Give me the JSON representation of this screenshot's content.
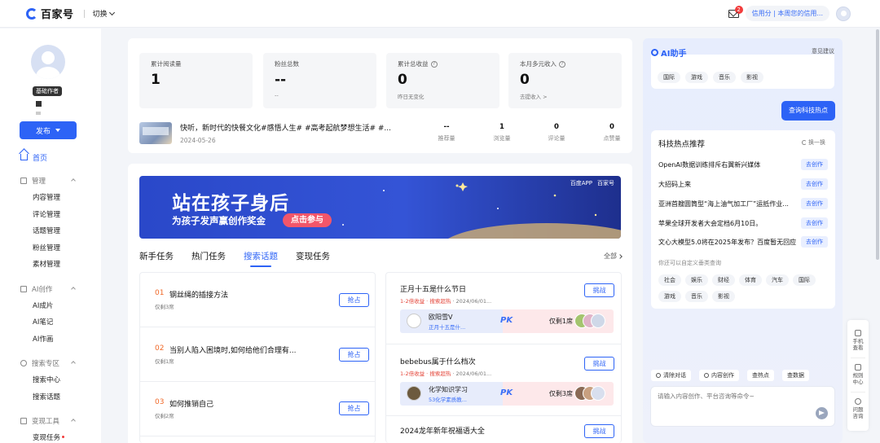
{
  "topbar": {
    "brand": "百家号",
    "switch_label": "切换",
    "mail_badge": "2",
    "credit_text": "信用分 | 本周您的信用..."
  },
  "sidebar": {
    "level_tag": "基础作者",
    "publish_label": "发布",
    "home_label": "首页",
    "groups": [
      {
        "title": "管理",
        "items": [
          "内容管理",
          "评论管理",
          "话题管理",
          "粉丝管理",
          "素材管理"
        ]
      },
      {
        "title": "AI创作",
        "items": [
          "AI成片",
          "AI笔记",
          "AI作画"
        ]
      },
      {
        "title": "搜索专区",
        "items": [
          "搜索中心",
          "搜索话题"
        ]
      },
      {
        "title": "变现工具",
        "items": [
          "变现任务"
        ]
      }
    ]
  },
  "stats": [
    {
      "label": "累计阅读量",
      "value": "1",
      "sub": ""
    },
    {
      "label": "粉丝总数",
      "value": "--",
      "sub": "--"
    },
    {
      "label": "累计总收益",
      "value": "0",
      "sub": "昨日无变化"
    },
    {
      "label": "本月多元收入",
      "value": "0",
      "sub": "去提收入 >"
    }
  ],
  "article": {
    "title": "快听，新时代的快餐文化#感悟人生# #高考起航梦想生活# #...",
    "date": "2024-05-26",
    "metrics": [
      {
        "value": "--",
        "label": "推荐量"
      },
      {
        "value": "1",
        "label": "浏览量"
      },
      {
        "value": "0",
        "label": "评论量"
      },
      {
        "value": "0",
        "label": "点赞量"
      }
    ]
  },
  "banner": {
    "title": "站在孩子身后",
    "subtitle": "为孩子发声赢创作奖金",
    "button": "点击参与",
    "logo_a": "百度APP",
    "logo_b": "百家号"
  },
  "tabs": [
    "新手任务",
    "热门任务",
    "搜索话题",
    "变现任务"
  ],
  "all_label": "全部",
  "topics": [
    {
      "num": "01",
      "title": "钢丝绳的插接方法",
      "sub": "仅剩3席",
      "button": "抢占"
    },
    {
      "num": "02",
      "title": "当别人陷入困境时,如何给他们合理有...",
      "sub": "仅剩1席",
      "button": "抢占"
    },
    {
      "num": "03",
      "title": "如何推销自己",
      "sub": "仅剩2席",
      "button": "抢占"
    }
  ],
  "challenges": [
    {
      "title": "正月十五是什么节日",
      "sub_hot": "1-2倍收益 · 搜索超热",
      "sub_date": " · 2024/06/01...",
      "button": "挑战",
      "author": "欧阳雪V",
      "desc": "正月十五是什...",
      "seats": "仅剩1席"
    },
    {
      "title": "bebebus属于什么档次",
      "sub_hot": "1-2倍收益 · 搜索超热",
      "sub_date": " · 2024/06/01...",
      "button": "挑战",
      "author": "化学知识学习",
      "desc": "53化学素质教...",
      "seats": "仅剩3席"
    },
    {
      "title": "2024龙年新年祝福语大全",
      "sub_hot": "",
      "sub_date": "",
      "button": "挑战",
      "author": "",
      "desc": "",
      "seats": ""
    }
  ],
  "pk_mark": "PK",
  "ai": {
    "title": "AI助手",
    "feedback": "意见建议",
    "top_chips": [
      "国际",
      "游戏",
      "音乐",
      "影视"
    ],
    "query_button": "查询科技热点",
    "hot_title": "科技热点推荐",
    "refresh": "换一换",
    "hot_items": [
      "OpenAI数据训练排斥右翼新兴媒体",
      "大招码上来",
      "亚洲首艘圆筒型“海上油气加工厂”运抵作业...",
      "苹果全球开发者大会定档6月10日。",
      "文心大模型5.0将在2025年发布？百度暂无回应"
    ],
    "go_label": "去创作",
    "hint": "你还可以自定义垂类查询",
    "chips": [
      "社会",
      "娱乐",
      "财经",
      "体育",
      "汽车",
      "国际",
      "游戏",
      "音乐",
      "影视"
    ],
    "actions": [
      "清除对话",
      "内容创作",
      "查热点",
      "查数据"
    ],
    "input_placeholder": "请输入内容创作、平台咨询等命令~"
  },
  "float_tools": [
    "手机查看",
    "规则中心",
    "问题咨询"
  ],
  "colors": {
    "accent": "#2d63f6",
    "hot": "#e4463a",
    "topic_num": "#f06a2a"
  }
}
